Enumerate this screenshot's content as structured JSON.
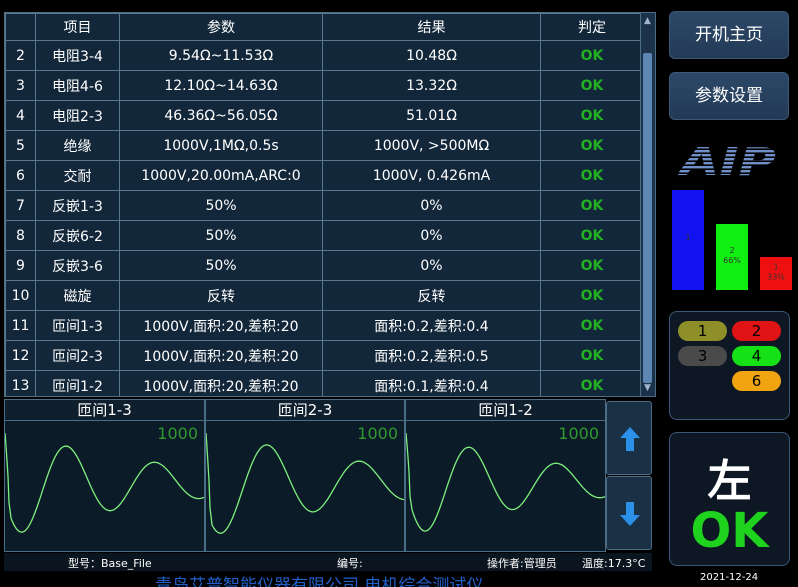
{
  "table": {
    "headers": [
      "",
      "项目",
      "参数",
      "结果",
      "判定"
    ],
    "rows": [
      [
        "2",
        "电阻3-4",
        "9.54Ω~11.53Ω",
        "10.48Ω",
        "OK"
      ],
      [
        "3",
        "电阻4-6",
        "12.10Ω~14.63Ω",
        "13.32Ω",
        "OK"
      ],
      [
        "4",
        "电阻2-3",
        "46.36Ω~56.05Ω",
        "51.01Ω",
        "OK"
      ],
      [
        "5",
        "绝缘",
        "1000V,1MΩ,0.5s",
        "1000V, >500MΩ",
        "OK"
      ],
      [
        "6",
        "交耐",
        "1000V,20.00mA,ARC:0",
        "1000V, 0.426mA",
        "OK"
      ],
      [
        "7",
        "反嵌1-3",
        "50%",
        "0%",
        "OK"
      ],
      [
        "8",
        "反嵌6-2",
        "50%",
        "0%",
        "OK"
      ],
      [
        "9",
        "反嵌3-6",
        "50%",
        "0%",
        "OK"
      ],
      [
        "10",
        "磁旋",
        "反转",
        "反转",
        "OK"
      ],
      [
        "11",
        "匝间1-3",
        "1000V,面积:20,差积:20",
        "面积:0.2,差积:0.4",
        "OK"
      ],
      [
        "12",
        "匝间2-3",
        "1000V,面积:20,差积:20",
        "面积:0.2,差积:0.5",
        "OK"
      ],
      [
        "13",
        "匝间1-2",
        "1000V,面积:20,差积:20",
        "面积:0.1,差积:0.4",
        "OK"
      ]
    ]
  },
  "waveforms": [
    {
      "title": "匝间1-3",
      "value": "1000"
    },
    {
      "title": "匝间2-3",
      "value": "1000"
    },
    {
      "title": "匝间1-2",
      "value": "1000"
    }
  ],
  "status_bar": {
    "model": "型号：Base_File",
    "serial": "编号:",
    "operator": "操作者:管理员",
    "temperature": "温度:17.3°C"
  },
  "footer_company": "青岛艾普智能仪器有限公司   电机综合测试仪",
  "date": "2021-12-24",
  "nav": {
    "home_label": "开机主页",
    "settings_label": "参数设置"
  },
  "logo_text": "AIP",
  "stats_chart": {
    "bars": [
      {
        "label": "1",
        "percent": "",
        "value": 100,
        "color": "#1212f0"
      },
      {
        "label": "2",
        "percent": "66%",
        "value": 66,
        "color": "#10f010"
      },
      {
        "label": "1",
        "percent": "33%",
        "value": 33,
        "color": "#ee1010"
      }
    ]
  },
  "stations": [
    {
      "label": "1",
      "color": "#8f8f2a"
    },
    {
      "label": "2",
      "color": "#e01414"
    },
    {
      "label": "3",
      "color": "#4a4a4a"
    },
    {
      "label": "4",
      "color": "#16e016"
    },
    {
      "label": "6",
      "color": "#f0a410"
    }
  ],
  "result": {
    "side": "左",
    "status": "OK"
  }
}
